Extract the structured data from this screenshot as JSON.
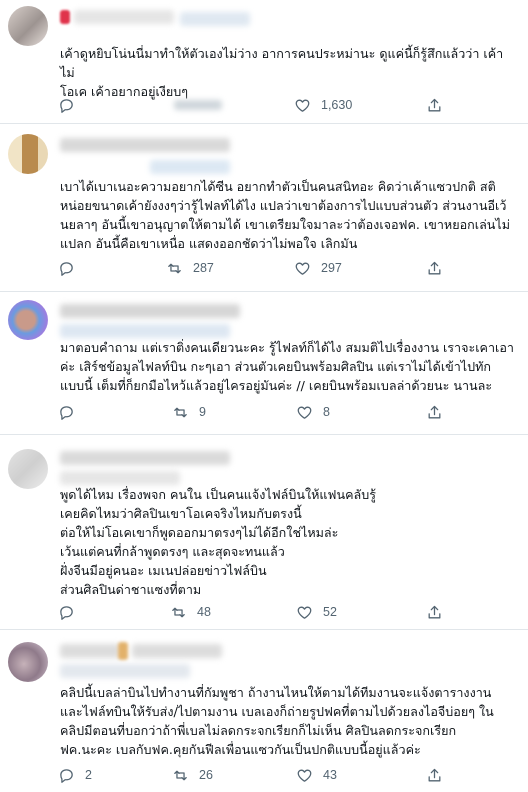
{
  "tweets": [
    {
      "text": "เค้าดูหยิบโน่นนี่มาทำให้ตัวเองไม่ว่าง อาการคนประหม่านะ ดูแค่นี้ก็รู้สึกแล้วว่า เค้าไม่\nโอเค เค้าอยากอยู่เงียบๆ",
      "replies": "",
      "retweets": "",
      "likes": "1,630"
    },
    {
      "text": "เบาได้เบาเนอะความอยากได้ซีน อยากทำตัวเป็นคนสนิทอะ คิดว่าเค้าแซวปกติ สติ\nหน่อยขนาดเค้ายังงงๆว่ารู้ไฟลท์ได้ไง แปลว่าเขาต้องการไปแบบส่วนตัว ส่วนงานอีเว้\nนยลาๆ อันนี้เขาอนุญาตให้ตามได้ เขาเตรียมใจมาละว่าต้องเจอฟค. เขาหยอกเล่นไม่\nแปลก อันนี้คือเขาเหนื่อ แสดงออกชัดว่าไม่พอใจ เลิกมัน",
      "replies": "",
      "retweets": "287",
      "likes": "297"
    },
    {
      "text": "มาตอบคำถาม แต่เราติ่งคนเดียวนะคะ รู้ไฟลท์ก็ได้ไง สมมติไปเรื่องงาน เราจะเคาเอา\nค่ะ เสิร์ชข้อมูลไฟลท์บิน กะๆเอา ส่วนตัวเคยบินพร้อมศิลปิน แต่เราไม่ได้เข้าไปทัก\nแบบนี้ เต็มที่ก็ยกมือไหว้แล้วอยู่ไครอยู่มันค่ะ // เคยบินพร้อมเบลล่าด้วยนะ นานละ",
      "replies": "",
      "retweets": "9",
      "likes": "8"
    },
    {
      "text": "พูดได้ไหม เรื่องพจก คนใน เป็นคนแจ้งไฟล์บินให้แฟนคลับรู้\nเคยคิดไหมว่าศิลปินเขาโอเคจริงไหมกับตรงนี้\nต่อให้ไม่โอเคเขาก็พูดออกมาตรงๆไม่ได้อีกใช่ไหมล่ะ\nเว้นแต่คนที่กล้าพูดตรงๆ และสุดจะทนแล้ว\nฝั่งจีนมีอยู่คนอะ เมเนปล่อยข่าวไฟล์บิน\nส่วนศิลปินด่าชาแซงที่ตาม",
      "replies": "",
      "retweets": "48",
      "likes": "52"
    },
    {
      "text": "คลิปนี้เบลล่าบินไปทำงานที่กัมพูชา ถ้างานไหนให้ตามได้ทีมงานจะแจ้งตารางงาน\nและไฟล์ทบินให้รับส่ง/ไปตามงาน เบลเองก็ถ่ายรูปฟคที่ตามไปด้วยลงไอจีบ่อยๆ ใน\nคลิปมีตอนที่บอกว่าถ้าพี่เบลไม่ลดกระจกเรียกก็ไม่เห็น ศิลปินลดกระจกเรียก\nฟค.นะคะ เบลกับฟค.คุยกันฟีลเพื่อนแซวกันเป็นปกติแบบนี้อยู่แล้วค่ะ",
      "replies": "2",
      "retweets": "26",
      "likes": "43"
    }
  ]
}
